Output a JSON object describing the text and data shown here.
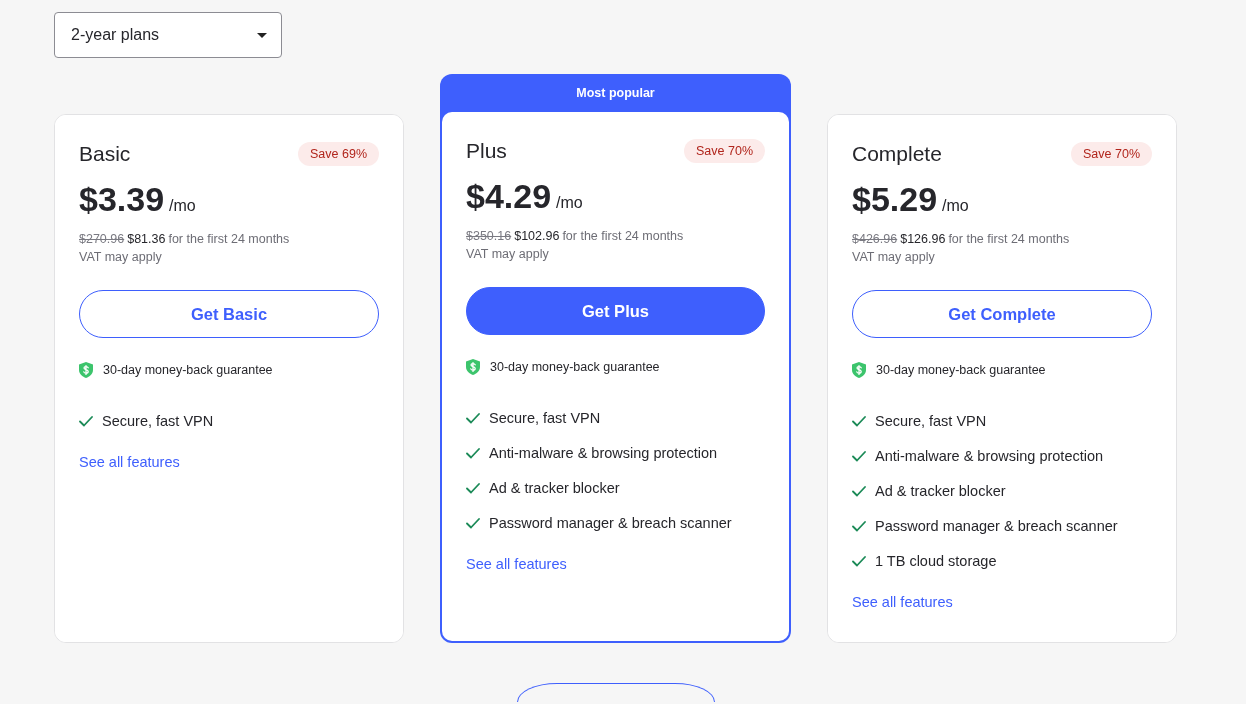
{
  "plan_selector": {
    "value": "2-year plans"
  },
  "plans": [
    {
      "name": "Basic",
      "highlighted": false,
      "save_badge": "Save 69%",
      "price": "$3.39",
      "price_unit": "/mo",
      "original_total": "$270.96",
      "total": "$81.36",
      "term": "for the first 24 months",
      "tax_note": "VAT may apply",
      "cta": "Get Basic",
      "guarantee": "30-day money-back guarantee",
      "features": [
        "Secure, fast VPN"
      ],
      "link": "See all features"
    },
    {
      "banner": "Most popular",
      "name": "Plus",
      "highlighted": true,
      "save_badge": "Save 70%",
      "price": "$4.29",
      "price_unit": "/mo",
      "original_total": "$350.16",
      "total": "$102.96",
      "term": "for the first 24 months",
      "tax_note": "VAT may apply",
      "cta": "Get Plus",
      "guarantee": "30-day money-back guarantee",
      "features": [
        "Secure, fast VPN",
        "Anti-malware & browsing protection",
        "Ad & tracker blocker",
        "Password manager & breach scanner"
      ],
      "link": "See all features"
    },
    {
      "name": "Complete",
      "highlighted": false,
      "save_badge": "Save 70%",
      "price": "$5.29",
      "price_unit": "/mo",
      "original_total": "$426.96",
      "total": "$126.96",
      "term": "for the first 24 months",
      "tax_note": "VAT may apply",
      "cta": "Get Complete",
      "guarantee": "30-day money-back guarantee",
      "features": [
        "Secure, fast VPN",
        "Anti-malware & browsing protection",
        "Ad & tracker blocker",
        "Password manager & breach scanner",
        "1 TB cloud storage"
      ],
      "link": "See all features"
    }
  ]
}
